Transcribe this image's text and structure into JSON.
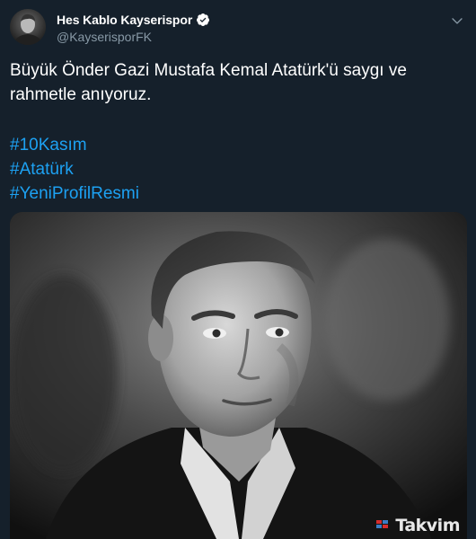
{
  "tweet": {
    "display_name": "Hes Kablo Kayserispor",
    "handle": "@KayserisporFK",
    "text": "Büyük Önder Gazi Mustafa Kemal Atatürk'ü saygı ve rahmetle anıyoruz.",
    "hashtags": [
      "#10Kasım",
      "#Atatürk",
      "#YeniProfilResmi"
    ],
    "verified": true
  },
  "icons": {
    "verified": "verified-badge-icon",
    "more": "chevron-down-icon"
  },
  "watermark": {
    "text": "Takvim"
  },
  "colors": {
    "background": "#15202b",
    "text": "#ffffff",
    "secondary_text": "#8899a6",
    "link": "#1da1f2"
  }
}
